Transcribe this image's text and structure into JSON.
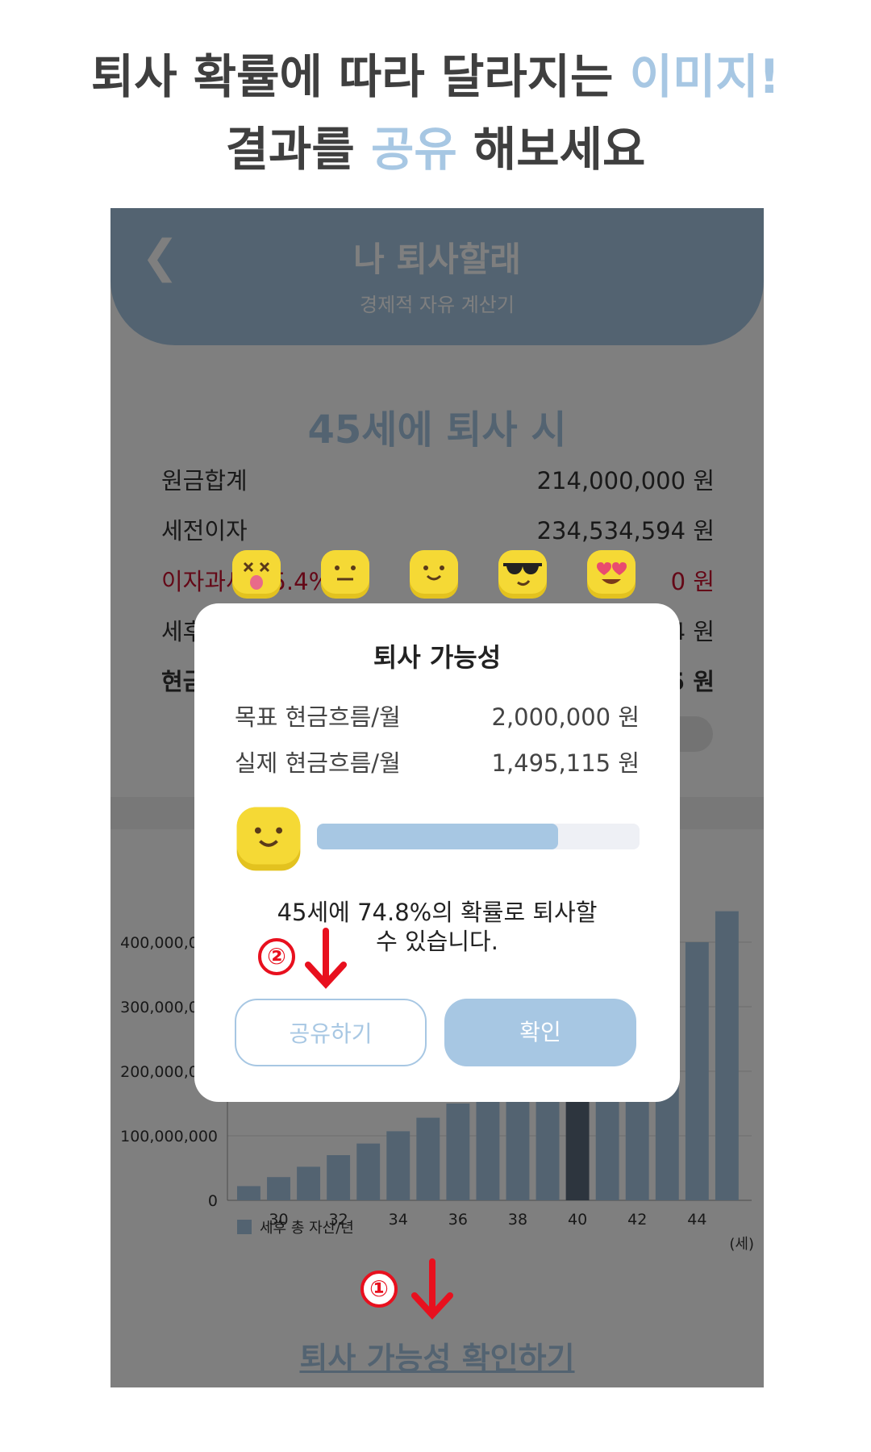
{
  "headline": {
    "line1_a": "퇴사 확률에 따라 달라지는 ",
    "line1_b": "이미지!",
    "line2_a": "결과를 ",
    "line2_b": "공유",
    "line2_c": " 해보세요"
  },
  "app": {
    "back_icon": "chevron-left-icon",
    "title": "나 퇴사할래",
    "subtitle": "경제적 자유 계산기"
  },
  "summary": {
    "title": "45세에 퇴사 시",
    "rows": [
      {
        "label": "원금합계",
        "value": "214,000,000",
        "unit": "원"
      },
      {
        "label": "세전이자",
        "value": "234,534,594",
        "unit": "원"
      },
      {
        "label": "이자과세(15.4%)",
        "value": "0",
        "unit": "원"
      },
      {
        "label": "세후",
        "value": "4",
        "unit": "원"
      },
      {
        "label": "현금",
        "value": "5",
        "unit": "원"
      }
    ]
  },
  "chart_data": {
    "type": "bar",
    "categories": [
      "29",
      "30",
      "31",
      "32",
      "33",
      "34",
      "35",
      "36",
      "37",
      "38",
      "39",
      "40",
      "41",
      "42",
      "43",
      "44",
      "45"
    ],
    "tick_labels": [
      "30",
      "32",
      "34",
      "36",
      "38",
      "40",
      "42",
      "44"
    ],
    "values": [
      22000000,
      36000000,
      52000000,
      70000000,
      88000000,
      107000000,
      128000000,
      150000000,
      174000000,
      200000000,
      228000000,
      258000000,
      290000000,
      324000000,
      360000000,
      400000000,
      448000000
    ],
    "highlight_index": 11,
    "y_ticks": [
      "0",
      "100,000,000",
      "200,000,000",
      "300,000,000",
      "400,000,000"
    ],
    "ylim": [
      0,
      450000000
    ],
    "legend": "세후 총 자산/년",
    "x_unit": "(세)",
    "colors": {
      "bar": "#a7c7e3",
      "highlight": "#5a6a7d"
    }
  },
  "bottom_link": "퇴사 가능성 확인하기",
  "modal": {
    "title": "퇴사 가능성",
    "target_label": "목표 현금흐름/월",
    "target_value": "2,000,000",
    "actual_label": "실제 현금흐름/월",
    "actual_value": "1,495,115",
    "unit": "원",
    "probability": 0.748,
    "message_line1": "45세에 74.8%의 확률로 퇴사할",
    "message_line2": "수 있습니다.",
    "share_button": "공유하기",
    "ok_button": "확인"
  },
  "emoji_row": [
    "dizzy-tongue-emoji-icon",
    "neutral-emoji-icon",
    "smile-emoji-icon",
    "sunglasses-emoji-icon",
    "heart-eyes-emoji-icon"
  ],
  "annotations": {
    "step1": "①",
    "step2": "②"
  },
  "colors": {
    "accent": "#a7c7e3",
    "danger": "#c8102e",
    "annotation": "#e8101e",
    "emoji": "#f5d935"
  }
}
